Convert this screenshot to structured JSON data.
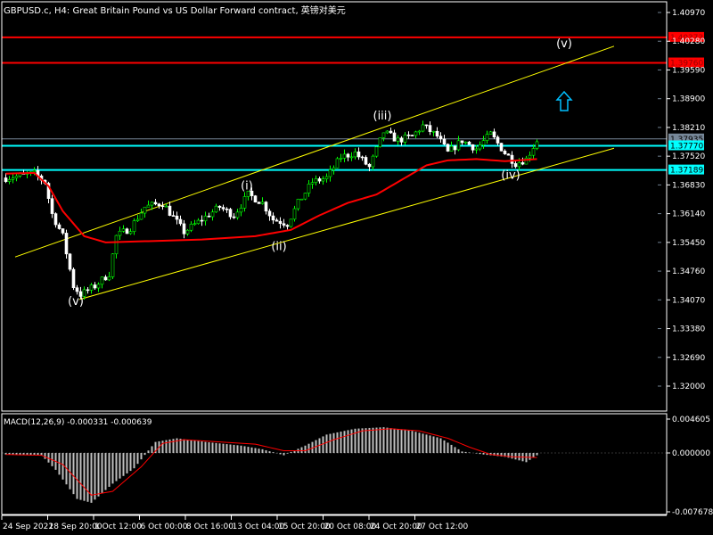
{
  "window": {
    "title": "GBPUSD.c, H4:  Great Britain Pound vs US Dollar Forward contract, 英镑对美元"
  },
  "macd": {
    "label": "MACD(12,26,9) -0.000331 -0.000639",
    "axis": [
      "0.004605",
      "0.000000",
      "-0.007678"
    ]
  },
  "colors": {
    "bg": "#000000",
    "bull": "#00ff00",
    "bear": "#ffffff",
    "ma": "#ff0000",
    "channel": "#ffff00",
    "support": "#00ffff",
    "resistance": "#ff0000",
    "grid": "#708090"
  },
  "price_axis": [
    "1.40970",
    "1.40280",
    "1.39590",
    "1.38900",
    "1.38210",
    "1.37520",
    "1.36830",
    "1.36140",
    "1.35450",
    "1.34760",
    "1.34070",
    "1.33380",
    "1.32690",
    "1.32000"
  ],
  "price_labels": [
    {
      "text": "1.40373",
      "price": 1.40373,
      "kind": "resistance"
    },
    {
      "text": "1.39760",
      "price": 1.3976,
      "kind": "resistance"
    },
    {
      "text": "1.37935",
      "price": 1.37935,
      "kind": "bid"
    },
    {
      "text": "1.37770",
      "price": 1.3777,
      "kind": "support"
    },
    {
      "text": "1.37189",
      "price": 1.37189,
      "kind": "support"
    }
  ],
  "time_axis": [
    "24 Sep 2021",
    "28 Sep 20:00",
    "1 Oct 12:00",
    "6 Oct 00:00",
    "8 Oct 16:00",
    "13 Oct 04:00",
    "15 Oct 20:00",
    "20 Oct 08:00",
    "24 Oct 20:00",
    "27 Oct 12:00"
  ],
  "waves": [
    {
      "text": "(v)",
      "bar": 20,
      "price": 1.3395
    },
    {
      "text": "(i)",
      "bar": 68,
      "price": 1.3672
    },
    {
      "text": "(ii)",
      "bar": 77,
      "price": 1.3527
    },
    {
      "text": "(iii)",
      "bar": 106,
      "price": 1.384
    },
    {
      "text": "(iv)",
      "bar": 142,
      "price": 1.3698
    },
    {
      "text": "(v)",
      "bar": 157,
      "price": 1.4013
    }
  ],
  "chart_data": {
    "type": "candlestick",
    "symbol": "GBPUSD.c",
    "timeframe": "H4",
    "ylim": [
      1.3166,
      1.4117
    ],
    "bars": 150,
    "price_path": [
      [
        0,
        1.37
      ],
      [
        8,
        1.371
      ],
      [
        11,
        1.369
      ],
      [
        13,
        1.3613
      ],
      [
        16,
        1.356
      ],
      [
        19,
        1.344
      ],
      [
        21,
        1.342
      ],
      [
        25,
        1.344
      ],
      [
        29,
        1.347
      ],
      [
        31,
        1.356
      ],
      [
        35,
        1.358
      ],
      [
        39,
        1.363
      ],
      [
        44,
        1.364
      ],
      [
        50,
        1.357
      ],
      [
        55,
        1.36
      ],
      [
        60,
        1.363
      ],
      [
        64,
        1.361
      ],
      [
        68,
        1.366
      ],
      [
        72,
        1.364
      ],
      [
        75,
        1.36
      ],
      [
        79,
        1.359
      ],
      [
        82,
        1.364
      ],
      [
        86,
        1.369
      ],
      [
        90,
        1.37
      ],
      [
        94,
        1.375
      ],
      [
        98,
        1.376
      ],
      [
        102,
        1.3725
      ],
      [
        106,
        1.381
      ],
      [
        110,
        1.379
      ],
      [
        114,
        1.38
      ],
      [
        117,
        1.3825
      ],
      [
        121,
        1.38
      ],
      [
        124,
        1.376
      ],
      [
        128,
        1.379
      ],
      [
        132,
        1.377
      ],
      [
        136,
        1.3805
      ],
      [
        140,
        1.376
      ],
      [
        143,
        1.3735
      ],
      [
        146,
        1.3745
      ],
      [
        149,
        1.379
      ]
    ],
    "ma_path": [
      [
        0,
        1.371
      ],
      [
        8,
        1.3712
      ],
      [
        12,
        1.368
      ],
      [
        16,
        1.362
      ],
      [
        22,
        1.356
      ],
      [
        28,
        1.3545
      ],
      [
        40,
        1.3548
      ],
      [
        55,
        1.3552
      ],
      [
        70,
        1.356
      ],
      [
        80,
        1.3575
      ],
      [
        88,
        1.361
      ],
      [
        96,
        1.364
      ],
      [
        104,
        1.366
      ],
      [
        112,
        1.37
      ],
      [
        118,
        1.373
      ],
      [
        124,
        1.3742
      ],
      [
        132,
        1.3745
      ],
      [
        140,
        1.374
      ],
      [
        149,
        1.3745
      ]
    ],
    "macd_hist": [
      [
        0,
        -0.0002
      ],
      [
        10,
        -0.0003
      ],
      [
        14,
        -0.0022
      ],
      [
        20,
        -0.006
      ],
      [
        24,
        -0.0065
      ],
      [
        30,
        -0.004
      ],
      [
        36,
        -0.002
      ],
      [
        42,
        0.0015
      ],
      [
        48,
        0.002
      ],
      [
        56,
        0.0015
      ],
      [
        66,
        0.001
      ],
      [
        72,
        0.0005
      ],
      [
        78,
        -0.0003
      ],
      [
        84,
        0.001
      ],
      [
        90,
        0.0025
      ],
      [
        98,
        0.0033
      ],
      [
        106,
        0.0035
      ],
      [
        114,
        0.003
      ],
      [
        122,
        0.002
      ],
      [
        128,
        0.0002
      ],
      [
        134,
        -0.0002
      ],
      [
        140,
        -0.0005
      ],
      [
        146,
        -0.0012
      ],
      [
        149,
        -0.0003
      ]
    ],
    "macd_signal": [
      [
        0,
        -0.0002
      ],
      [
        10,
        -0.0003
      ],
      [
        16,
        -0.0015
      ],
      [
        24,
        -0.0055
      ],
      [
        30,
        -0.005
      ],
      [
        38,
        -0.0018
      ],
      [
        44,
        0.0013
      ],
      [
        50,
        0.0018
      ],
      [
        60,
        0.0015
      ],
      [
        70,
        0.0012
      ],
      [
        78,
        0.0003
      ],
      [
        84,
        0.0003
      ],
      [
        92,
        0.0018
      ],
      [
        100,
        0.003
      ],
      [
        108,
        0.0033
      ],
      [
        116,
        0.003
      ],
      [
        124,
        0.002
      ],
      [
        130,
        0.0008
      ],
      [
        136,
        -0.0002
      ],
      [
        142,
        -0.0005
      ],
      [
        149,
        -0.0006
      ]
    ],
    "lines": {
      "horizontal": [
        1.40373,
        1.3976,
        1.3777,
        1.37189
      ],
      "channel_upper": [
        [
          3,
          1.351
        ],
        [
          171,
          1.4016
        ]
      ],
      "channel_lower": [
        [
          21,
          1.3408
        ],
        [
          171,
          1.3771
        ]
      ]
    }
  }
}
